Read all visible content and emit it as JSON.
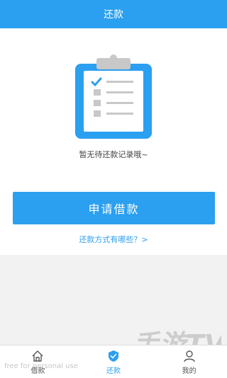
{
  "header": {
    "title": "还款"
  },
  "empty_state": {
    "icon": "clipboard-checklist-icon",
    "message": "暂无待还款记录哦~"
  },
  "actions": {
    "apply_label": "申请借款",
    "help_link": "还款方式有哪些？>"
  },
  "tabbar": {
    "items": [
      {
        "label": "借款",
        "icon": "home-icon",
        "active": false
      },
      {
        "label": "还款",
        "icon": "shield-check-icon",
        "active": true
      },
      {
        "label": "我的",
        "icon": "user-icon",
        "active": false
      }
    ]
  },
  "watermark": {
    "text": "free for personal use",
    "logo_text": "手游TV"
  },
  "colors": {
    "accent": "#2b9ff0",
    "background": "#f2f2f2"
  }
}
